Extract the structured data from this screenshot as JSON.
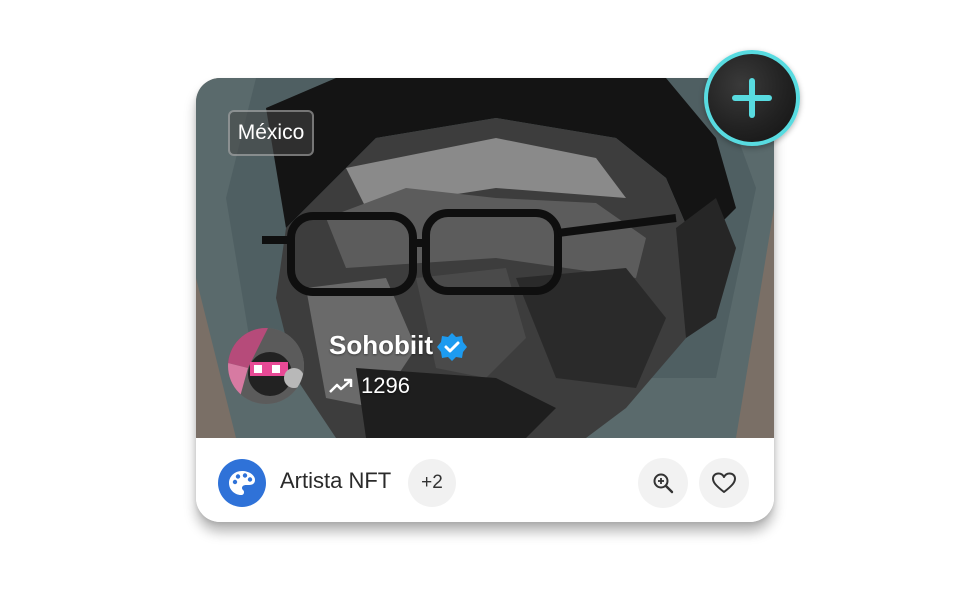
{
  "card": {
    "location": "México",
    "profile": {
      "name": "Sohobiit",
      "verified": true,
      "trend_count": "1296"
    },
    "footer": {
      "category_label": "Artista NFT",
      "more_count": "+2"
    }
  },
  "icons": {
    "add": "plus-icon",
    "verified": "verified-badge-icon",
    "trend": "trending-up-icon",
    "category": "palette-icon",
    "zoom": "zoom-in-icon",
    "like": "heart-icon"
  },
  "colors": {
    "add_ring": "#58dbe0",
    "verified_badge": "#1d9bf0",
    "category_icon_bg": "#2f72d8"
  }
}
